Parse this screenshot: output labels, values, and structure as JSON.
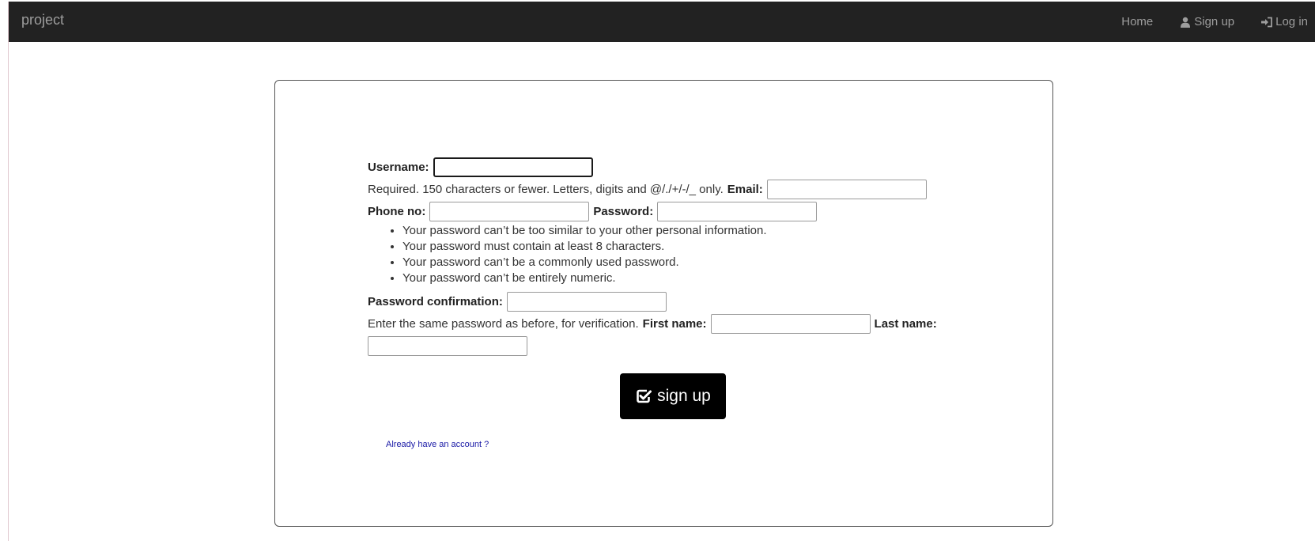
{
  "navbar": {
    "brand": "project",
    "links": {
      "home": "Home",
      "signup": "Sign up",
      "login": "Log in"
    },
    "icons": {
      "signup": "user-icon",
      "login": "login-icon"
    },
    "background": "#222222",
    "link_color": "#9d9d9d"
  },
  "form": {
    "username": {
      "label": "Username:",
      "value": "",
      "help": "Required. 150 characters or fewer. Letters, digits and @/./+/-/_ only."
    },
    "email": {
      "label": "Email:",
      "value": ""
    },
    "phone": {
      "label": "Phone no:",
      "value": ""
    },
    "password": {
      "label": "Password:",
      "value": "",
      "rules": [
        "Your password can’t be too similar to your other personal information.",
        "Your password must contain at least 8 characters.",
        "Your password can’t be a commonly used password.",
        "Your password can’t be entirely numeric."
      ]
    },
    "password_confirmation": {
      "label": "Password confirmation:",
      "value": "",
      "help": "Enter the same password as before, for verification."
    },
    "first_name": {
      "label": "First name:",
      "value": ""
    },
    "last_name": {
      "label": "Last name:",
      "value": ""
    },
    "submit": {
      "label": "sign up",
      "icon": "check-square-icon",
      "background": "#000000"
    },
    "already_link": "Already have an account ?"
  }
}
